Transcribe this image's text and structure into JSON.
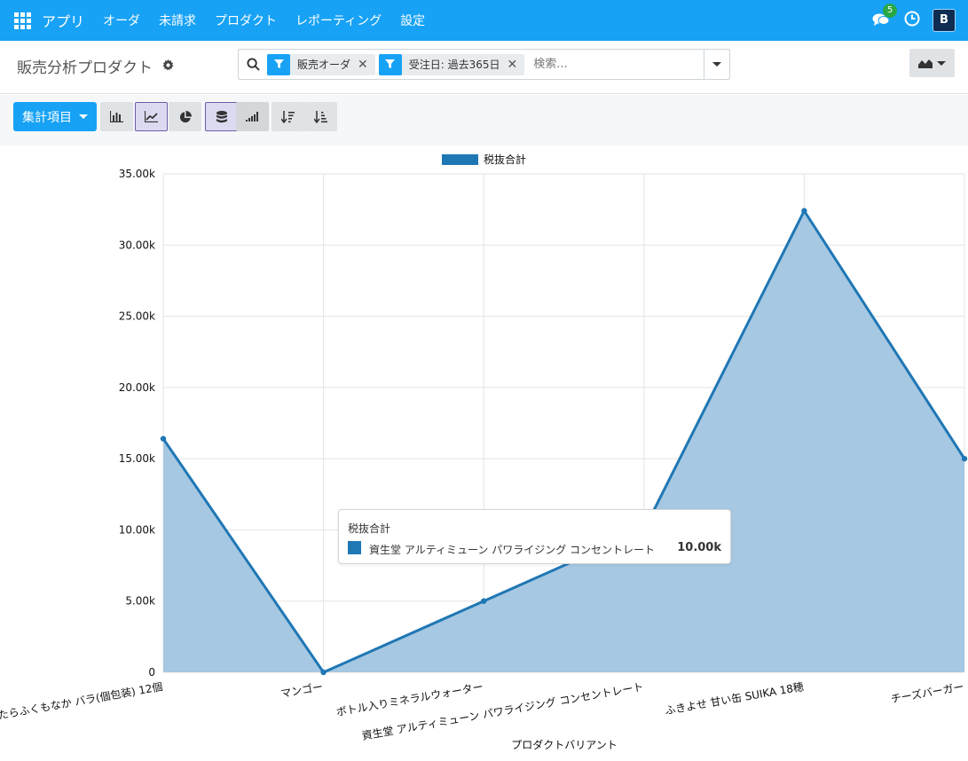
{
  "navbar": {
    "brand": "アプリ",
    "menu": [
      "オーダ",
      "未請求",
      "プロダクト",
      "レポーティング",
      "設定"
    ],
    "messages_count": "5",
    "avatar_letter": "B"
  },
  "control_panel": {
    "title": "販売分析プロダクト",
    "facets": [
      {
        "label": "販売オーダ"
      },
      {
        "label": "受注日: 過去365日"
      }
    ],
    "search_placeholder": "検索..."
  },
  "toolbar": {
    "measures_label": "集計項目"
  },
  "colors": {
    "accent": "#17a2f5",
    "series": "#1f77b4",
    "series_fill": "#a6c8e2"
  },
  "chart_data": {
    "type": "area",
    "xlabel": "プロダクトバリアント",
    "ylabel": "",
    "ylim": [
      0,
      35000
    ],
    "yticks": [
      "0",
      "5.00k",
      "10.00k",
      "15.00k",
      "20.00k",
      "25.00k",
      "30.00k",
      "35.00k"
    ],
    "legend_position": "top",
    "grid": true,
    "categories": [
      "たらふくもなか バラ(個包装) 12個",
      "マンゴー",
      "ボトル入りミネラルウォーター",
      "資生堂 アルティミューン パワライジング コンセントレート",
      "ふきよせ 甘い缶 SUIKA 18穂",
      "チーズバーガー"
    ],
    "series": [
      {
        "name": "税抜合計",
        "values": [
          16400,
          0,
          5000,
          10000,
          32400,
          15000
        ]
      }
    ],
    "tooltip": {
      "title": "税抜合計",
      "label": "資生堂 アルティミューン パワライジング コンセントレート",
      "value": "10.00k"
    }
  }
}
